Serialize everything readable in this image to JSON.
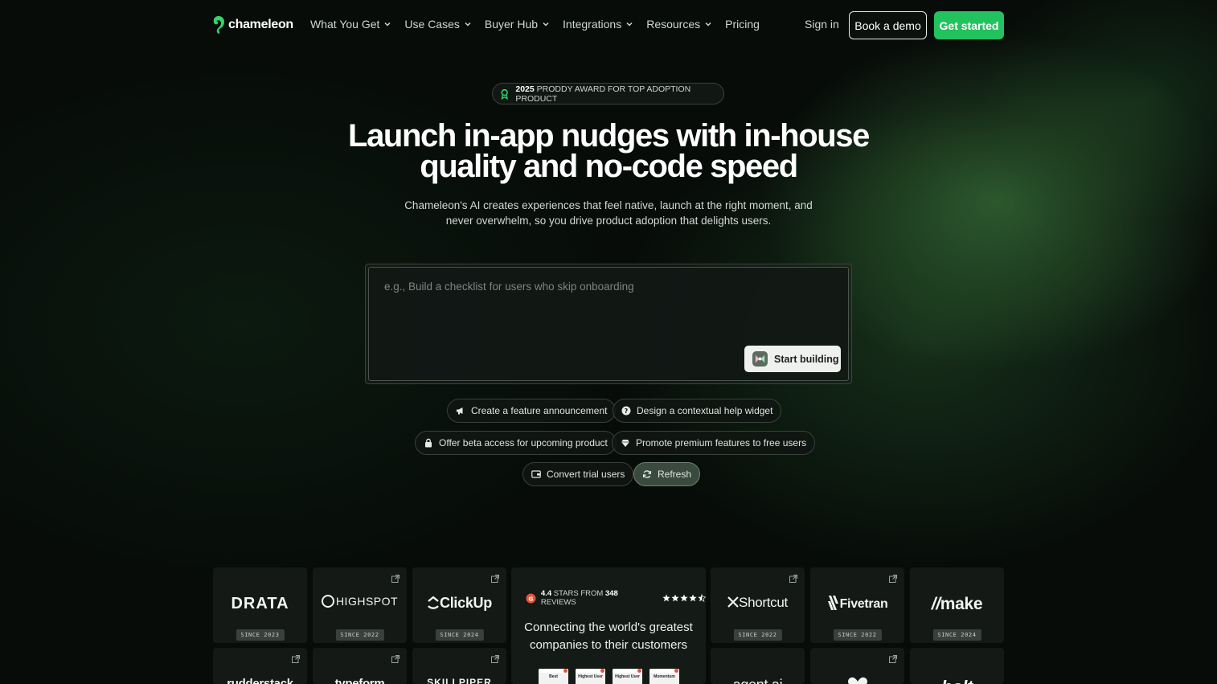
{
  "nav": {
    "brand": "chameleon",
    "menu": [
      {
        "label": "What You Get",
        "has_dropdown": true
      },
      {
        "label": "Use Cases",
        "has_dropdown": true
      },
      {
        "label": "Buyer Hub",
        "has_dropdown": true
      },
      {
        "label": "Integrations",
        "has_dropdown": true
      },
      {
        "label": "Resources",
        "has_dropdown": true
      },
      {
        "label": "Pricing",
        "has_dropdown": false
      }
    ],
    "sign_in": "Sign in",
    "book_demo": "Book a demo",
    "get_started": "Get started"
  },
  "hero": {
    "award_year": "2025",
    "award_text": "PRODDY AWARD FOR TOP ADOPTION PRODUCT",
    "headline_line1": "Launch in-app nudges with in-house",
    "headline_line2": "quality and no-code speed",
    "subtitle": "Chameleon's AI creates experiences that feel native, launch at the right moment, and never overwhelm, so you drive product adoption that delights users."
  },
  "prompt": {
    "placeholder": "e.g., Build a checklist for users who skip onboarding",
    "value": "",
    "submit_label": "Start building"
  },
  "suggestions": [
    {
      "label": "Create a feature announcement",
      "icon": "megaphone-icon"
    },
    {
      "label": "Design a contextual help widget",
      "icon": "question-circle-icon"
    },
    {
      "label": "Offer beta access for upcoming product",
      "icon": "lock-icon"
    },
    {
      "label": "Promote premium features to free users",
      "icon": "gem-icon"
    },
    {
      "label": "Convert trial users",
      "icon": "card-icon"
    },
    {
      "label": "Refresh",
      "icon": "refresh-icon"
    }
  ],
  "customers": [
    {
      "name": "DRATA",
      "since": "SINCE 2023",
      "has_link": false
    },
    {
      "name": "HIGHSPOT",
      "since": "SINCE 2022",
      "has_link": true
    },
    {
      "name": "ClickUp",
      "since": "SINCE 2024",
      "has_link": true
    },
    {
      "name": "Shortcut",
      "since": "SINCE 2022",
      "has_link": true
    },
    {
      "name": "Fivetran",
      "since": "SINCE 2022",
      "has_link": true
    },
    {
      "name": "make",
      "since": "SINCE 2024",
      "has_link": false
    }
  ],
  "customers_row2": [
    {
      "name": "rudderstack",
      "has_link": true
    },
    {
      "name": "typeform",
      "has_link": true
    },
    {
      "name": "SKILLPIPER",
      "has_link": true
    },
    {
      "name": "agent.ai",
      "has_link": false
    },
    {
      "name": "heartbeat",
      "has_link": true
    },
    {
      "name": "bolt",
      "has_link": false
    }
  ],
  "g2": {
    "score": "4.4",
    "stars_from": "STARS FROM",
    "count": "348",
    "reviews": "REVIEWS",
    "rating_value": 4.5,
    "tagline": "Connecting the world's greatest companies to their customers",
    "badges": [
      "Best",
      "Highest User",
      "Highest User",
      "Momentum"
    ]
  },
  "colors": {
    "accent_green": "#22c35e",
    "background": "#070c09",
    "g2_red": "#e2553a"
  }
}
